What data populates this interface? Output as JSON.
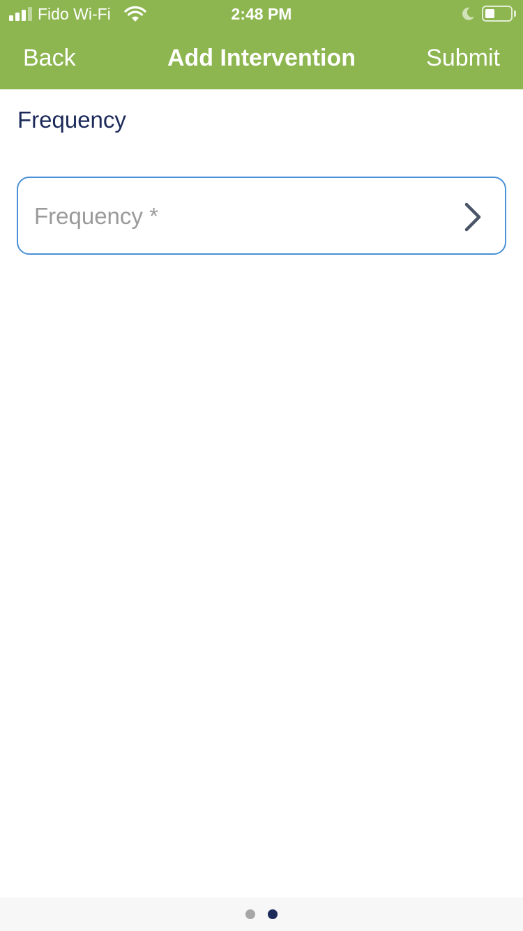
{
  "status_bar": {
    "carrier": "Fido Wi-Fi",
    "time": "2:48 PM",
    "icons": [
      "signal-icon",
      "wifi-icon",
      "moon-icon",
      "battery-icon"
    ]
  },
  "nav": {
    "back_label": "Back",
    "title": "Add Intervention",
    "submit_label": "Submit"
  },
  "section": {
    "title": "Frequency"
  },
  "frequency_field": {
    "placeholder": "Frequency *",
    "value": "",
    "icon": "chevron-right-icon"
  },
  "pager": {
    "pages": 2,
    "active_page": 2
  },
  "colors": {
    "header": "#8db650",
    "section_title": "#1c2a5a",
    "field_border": "#4a90d6",
    "dot_inactive": "#a7a7a7",
    "dot_active": "#1c2a5a"
  }
}
